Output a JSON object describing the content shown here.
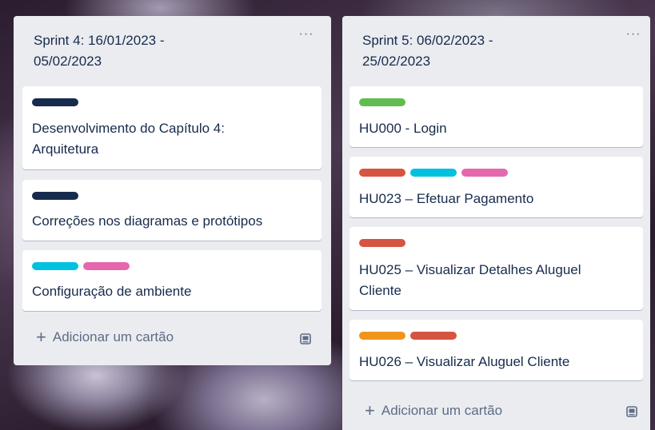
{
  "lists": [
    {
      "title_lines": [
        "Sprint 4: 16/01/2023 -",
        "05/02/2023"
      ],
      "menu": "···",
      "cards": [
        {
          "labels": [
            "#172b4d"
          ],
          "title_lines": [
            "Desenvolvimento do Capítulo 4:",
            "Arquitetura"
          ]
        },
        {
          "labels": [
            "#172b4d"
          ],
          "title_lines": [
            "Correções nos diagramas e protótipos"
          ]
        },
        {
          "labels": [
            "#00c2e0",
            "#e568af"
          ],
          "title_lines": [
            "Configuração de ambiente"
          ]
        }
      ],
      "add_card": {
        "plus": "+",
        "label": "Adicionar um cartão"
      }
    },
    {
      "title_lines": [
        "Sprint 5: 06/02/2023 -",
        "25/02/2023"
      ],
      "menu": "···",
      "cards": [
        {
          "labels": [
            "#61bd4f"
          ],
          "title_lines": [
            "HU000 - Login"
          ]
        },
        {
          "labels": [
            "#d65442",
            "#00c2e0",
            "#e568af"
          ],
          "title_lines": [
            "HU023 – Efetuar Pagamento"
          ]
        },
        {
          "labels": [
            "#d65442"
          ],
          "title_lines": [
            "HU025 – Visualizar Detalhes Aluguel",
            "Cliente"
          ]
        },
        {
          "labels": [
            "#ef951d",
            "#d65442"
          ],
          "title_lines": [
            "HU026 – Visualizar Aluguel Cliente"
          ]
        }
      ],
      "add_card": {
        "plus": "+",
        "label": "Adicionar um cartão"
      }
    }
  ],
  "icons": {
    "list_menu": "ellipsis-icon",
    "template": "card-template-icon"
  }
}
